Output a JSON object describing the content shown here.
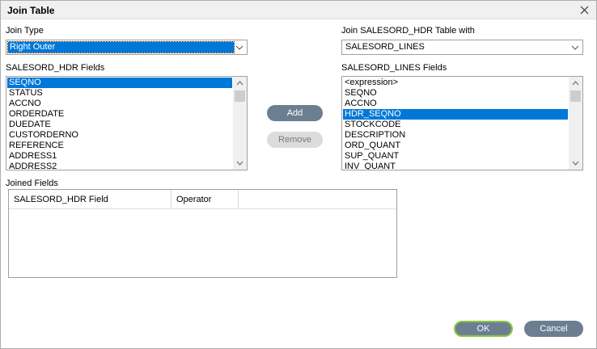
{
  "window": {
    "title": "Join Table"
  },
  "join_type": {
    "label": "Join Type",
    "value": "Right Outer"
  },
  "join_with": {
    "label": "Join SALESORD_HDR Table with",
    "value": "SALESORD_LINES"
  },
  "left_fields": {
    "label": "SALESORD_HDR Fields",
    "items": [
      "SEQNO",
      "STATUS",
      "ACCNO",
      "ORDERDATE",
      "DUEDATE",
      "CUSTORDERNO",
      "REFERENCE",
      "ADDRESS1",
      "ADDRESS2"
    ],
    "selected": "SEQNO"
  },
  "right_fields": {
    "label": "SALESORD_LINES Fields",
    "items": [
      "<expression>",
      "SEQNO",
      "ACCNO",
      "HDR_SEQNO",
      "STOCKCODE",
      "DESCRIPTION",
      "ORD_QUANT",
      "SUP_QUANT",
      "INV_QUANT"
    ],
    "selected": "HDR_SEQNO"
  },
  "buttons": {
    "add": "Add",
    "remove": "Remove",
    "ok": "OK",
    "cancel": "Cancel"
  },
  "joined_fields": {
    "label": "Joined Fields",
    "columns": [
      "SALESORD_HDR Field",
      "Operator"
    ]
  }
}
